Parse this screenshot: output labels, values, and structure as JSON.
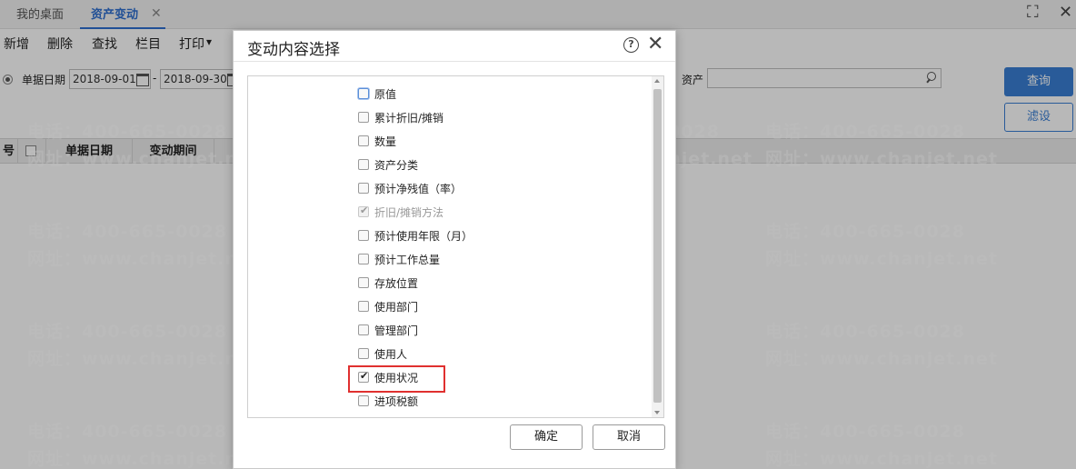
{
  "tabs": [
    {
      "label": "我的桌面"
    },
    {
      "label": "资产变动"
    }
  ],
  "tab_close_glyph": "✕",
  "window_controls": {
    "maximize": "⛶",
    "close": "✕"
  },
  "toolbar": {
    "items": [
      "新增",
      "删除",
      "查找",
      "栏目",
      "打印"
    ],
    "print_arrow": "▾"
  },
  "filter": {
    "date_label": "单据日期",
    "date_from": "2018-09-01",
    "separator": "-",
    "date_to": "2018-09-30",
    "asset_label": "资产",
    "asset_value": "",
    "query_button": "查询",
    "filter_button": "滤设"
  },
  "grid": {
    "columns": [
      "号",
      "单据日期",
      "变动期间"
    ]
  },
  "watermark": {
    "phone": "电话：400-665-0028",
    "site": "网址：www.chanjet.net"
  },
  "dialog": {
    "title": "变动内容选择",
    "help_glyph": "?",
    "close_glyph": "✕",
    "options": [
      {
        "label": "原值",
        "checked": false,
        "disabled": false
      },
      {
        "label": "累计折旧/摊销",
        "checked": false,
        "disabled": false
      },
      {
        "label": "数量",
        "checked": false,
        "disabled": false
      },
      {
        "label": "资产分类",
        "checked": false,
        "disabled": false
      },
      {
        "label": "预计净残值（率）",
        "checked": false,
        "disabled": false
      },
      {
        "label": "折旧/摊销方法",
        "checked": true,
        "disabled": true
      },
      {
        "label": "预计使用年限（月）",
        "checked": false,
        "disabled": false
      },
      {
        "label": "预计工作总量",
        "checked": false,
        "disabled": false
      },
      {
        "label": "存放位置",
        "checked": false,
        "disabled": false
      },
      {
        "label": "使用部门",
        "checked": false,
        "disabled": false
      },
      {
        "label": "管理部门",
        "checked": false,
        "disabled": false
      },
      {
        "label": "使用人",
        "checked": false,
        "disabled": false
      },
      {
        "label": "使用状况",
        "checked": true,
        "disabled": false
      },
      {
        "label": "进项税额",
        "checked": false,
        "disabled": false
      }
    ],
    "ok_button": "确定",
    "cancel_button": "取消"
  }
}
